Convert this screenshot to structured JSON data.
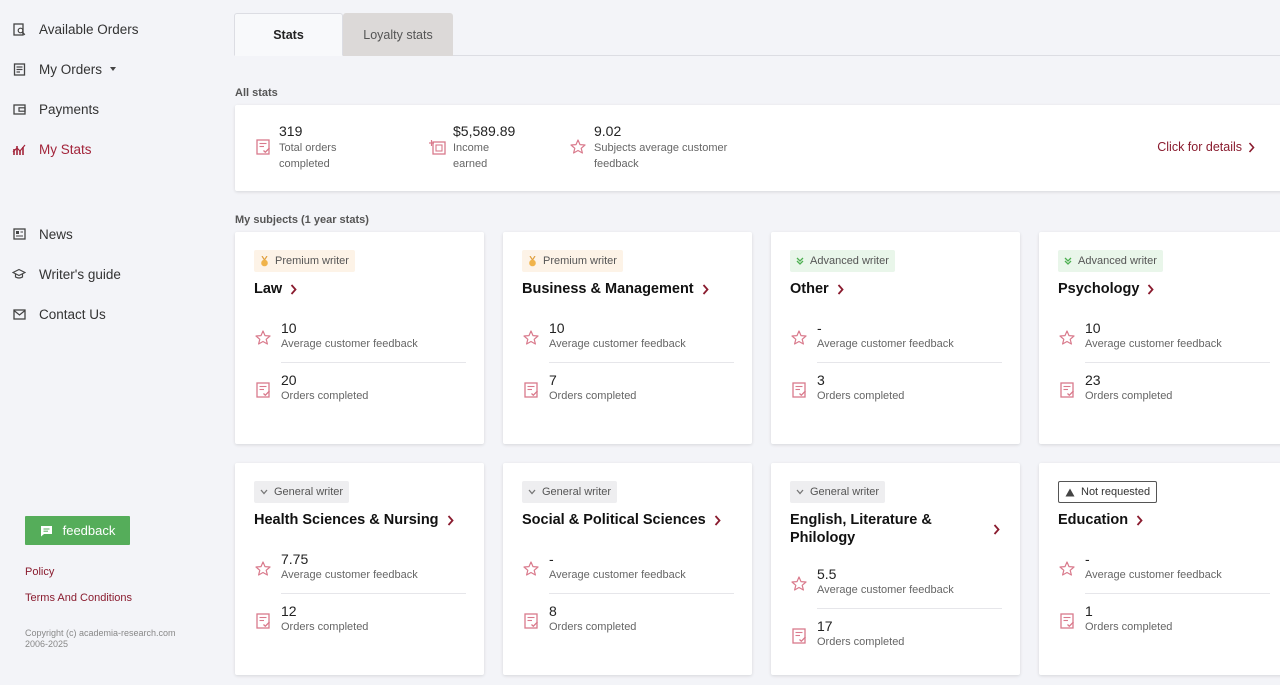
{
  "sidebar": {
    "items": [
      {
        "label": "Available Orders",
        "icon": "search-doc-icon"
      },
      {
        "label": "My Orders",
        "icon": "orders-icon"
      },
      {
        "label": "Payments",
        "icon": "wallet-icon"
      },
      {
        "label": "My Stats",
        "icon": "stats-icon"
      },
      {
        "label": "News",
        "icon": "news-icon"
      },
      {
        "label": "Writer's guide",
        "icon": "graduation-cap-icon"
      },
      {
        "label": "Contact Us",
        "icon": "mail-icon"
      }
    ],
    "feedback_label": "feedback",
    "policy_label": "Policy",
    "terms_label": "Terms And Conditions",
    "copyright": "Copyright (c) academia-research.com 2006-2025"
  },
  "tabs": [
    {
      "label": "Stats",
      "active": true
    },
    {
      "label": "Loyalty stats",
      "active": false
    }
  ],
  "all_stats": {
    "title": "All stats",
    "items": [
      {
        "value": "319",
        "label": "Total orders completed",
        "icon": "orders-check-icon"
      },
      {
        "value": "$5,589.89",
        "label": "Income earned",
        "icon": "income-icon"
      },
      {
        "value": "9.02",
        "label": "Subjects average customer feedback",
        "icon": "star-icon"
      }
    ],
    "details_label": "Click for details"
  },
  "subjects": {
    "title": "My subjects (1 year stats)",
    "cards": [
      {
        "badge": "Premium writer",
        "tier": "premium",
        "name": "Law",
        "feedback": "10",
        "feedback_label": "Average customer feedback",
        "orders": "20",
        "orders_label": "Orders completed"
      },
      {
        "badge": "Premium writer",
        "tier": "premium",
        "name": "Business & Management",
        "feedback": "10",
        "feedback_label": "Average customer feedback",
        "orders": "7",
        "orders_label": "Orders completed"
      },
      {
        "badge": "Advanced writer",
        "tier": "advanced",
        "name": "Other",
        "feedback": "-",
        "feedback_label": "Average customer feedback",
        "orders": "3",
        "orders_label": "Orders completed"
      },
      {
        "badge": "Advanced writer",
        "tier": "advanced",
        "name": "Psychology",
        "feedback": "10",
        "feedback_label": "Average customer feedback",
        "orders": "23",
        "orders_label": "Orders completed"
      },
      {
        "badge": "General writer",
        "tier": "general",
        "name": "Health Sciences & Nursing",
        "feedback": "7.75",
        "feedback_label": "Average customer feedback",
        "orders": "12",
        "orders_label": "Orders completed"
      },
      {
        "badge": "General writer",
        "tier": "general",
        "name": "Social & Political Sciences",
        "feedback": "-",
        "feedback_label": "Average customer feedback",
        "orders": "8",
        "orders_label": "Orders completed"
      },
      {
        "badge": "General writer",
        "tier": "general",
        "name": "English, Literature & Philology",
        "feedback": "5.5",
        "feedback_label": "Average customer feedback",
        "orders": "17",
        "orders_label": "Orders completed"
      },
      {
        "badge": "Not requested",
        "tier": "notreq",
        "name": "Education",
        "feedback": "-",
        "feedback_label": "Average customer feedback",
        "orders": "1",
        "orders_label": "Orders completed"
      }
    ]
  },
  "colors": {
    "accent": "#a3253b",
    "link": "#8a1c2f",
    "feedback_button": "#55ad5a",
    "icon_pink": "#d97a8c"
  }
}
